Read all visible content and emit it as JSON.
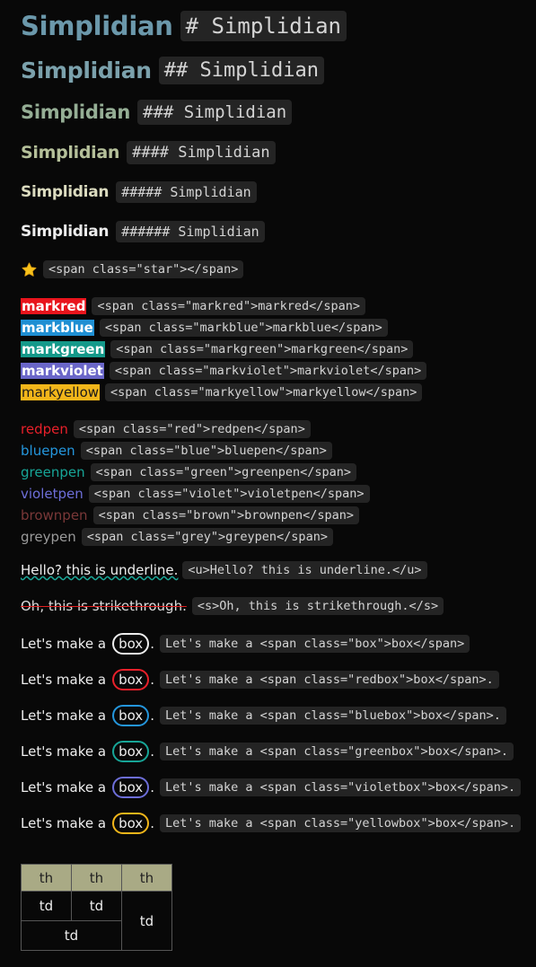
{
  "headings": [
    {
      "text": "Simplidian",
      "code": "# Simplidian"
    },
    {
      "text": "Simplidian",
      "code": "## Simplidian"
    },
    {
      "text": "Simplidian",
      "code": "### Simplidian"
    },
    {
      "text": "Simplidian",
      "code": "#### Simplidian"
    },
    {
      "text": "Simplidian",
      "code": "##### Simplidian"
    },
    {
      "text": "Simplidian",
      "code": "###### Simplidian"
    }
  ],
  "star": {
    "icon": "star-icon",
    "code": "<span class=\"star\"></span>"
  },
  "marks": [
    {
      "text": "markred",
      "code": "<span class=\"markred\">markred</span>",
      "bg": "#e8141c",
      "fg": "#ffffff"
    },
    {
      "text": "markblue",
      "code": "<span class=\"markblue\">markblue</span>",
      "bg": "#1f8fd3",
      "fg": "#ffffff"
    },
    {
      "text": "markgreen",
      "code": "<span class=\"markgreen\">markgreen</span>",
      "bg": "#14998a",
      "fg": "#ffffff"
    },
    {
      "text": "markviolet",
      "code": "<span class=\"markviolet\">markviolet</span>",
      "bg": "#6a66c8",
      "fg": "#ffffff"
    },
    {
      "text": "markyellow",
      "code": "<span class=\"markyellow\">markyellow</span>",
      "bg": "#f2b61a",
      "fg": "#1a1a1a"
    }
  ],
  "pens": [
    {
      "text": "redpen",
      "code": "<span class=\"red\">redpen</span>",
      "color": "#e8202a"
    },
    {
      "text": "bluepen",
      "code": "<span class=\"blue\">bluepen</span>",
      "color": "#2496dc"
    },
    {
      "text": "greenpen",
      "code": "<span class=\"green\">greenpen</span>",
      "color": "#17a597"
    },
    {
      "text": "violetpen",
      "code": "<span class=\"violet\">violetpen</span>",
      "color": "#6d6ed8"
    },
    {
      "text": "brownpen",
      "code": "<span class=\"brown\">brownpen</span>",
      "color": "#7a3838"
    },
    {
      "text": "greypen",
      "code": "<span class=\"grey\">greypen</span>",
      "color": "#9a9a9a"
    }
  ],
  "underline": {
    "text": "Hello? this is underline.",
    "code": "<u>Hello? this is underline.</u>"
  },
  "strike": {
    "text": "Oh, this is strikethrough.",
    "code": "<s>Oh, this is strikethrough.</s>"
  },
  "boxes": [
    {
      "prefix": "Let's make a",
      "box": "box",
      "suffix": ".",
      "code": "Let's make a <span class=\"box\">box</span>",
      "color": "#eeeeee"
    },
    {
      "prefix": "Let's make a",
      "box": "box",
      "suffix": ".",
      "code": "Let's make a <span class=\"redbox\">box</span>.",
      "color": "#e8202a"
    },
    {
      "prefix": "Let's make a",
      "box": "box",
      "suffix": ".",
      "code": "Let's make a <span class=\"bluebox\">box</span>.",
      "color": "#2496dc"
    },
    {
      "prefix": "Let's make a",
      "box": "box",
      "suffix": ".",
      "code": "Let's make a <span class=\"greenbox\">box</span>.",
      "color": "#17a597"
    },
    {
      "prefix": "Let's make a",
      "box": "box",
      "suffix": ".",
      "code": "Let's make a <span class=\"violetbox\">box</span>.",
      "color": "#6d6ed8"
    },
    {
      "prefix": "Let's make a",
      "box": "box",
      "suffix": ".",
      "code": "Let's make a <span class=\"yellowbox\">box</span>.",
      "color": "#f2b61a"
    }
  ],
  "table": {
    "headers": [
      "th",
      "th",
      "th"
    ],
    "cells": [
      "td",
      "td",
      "td",
      "td"
    ]
  }
}
